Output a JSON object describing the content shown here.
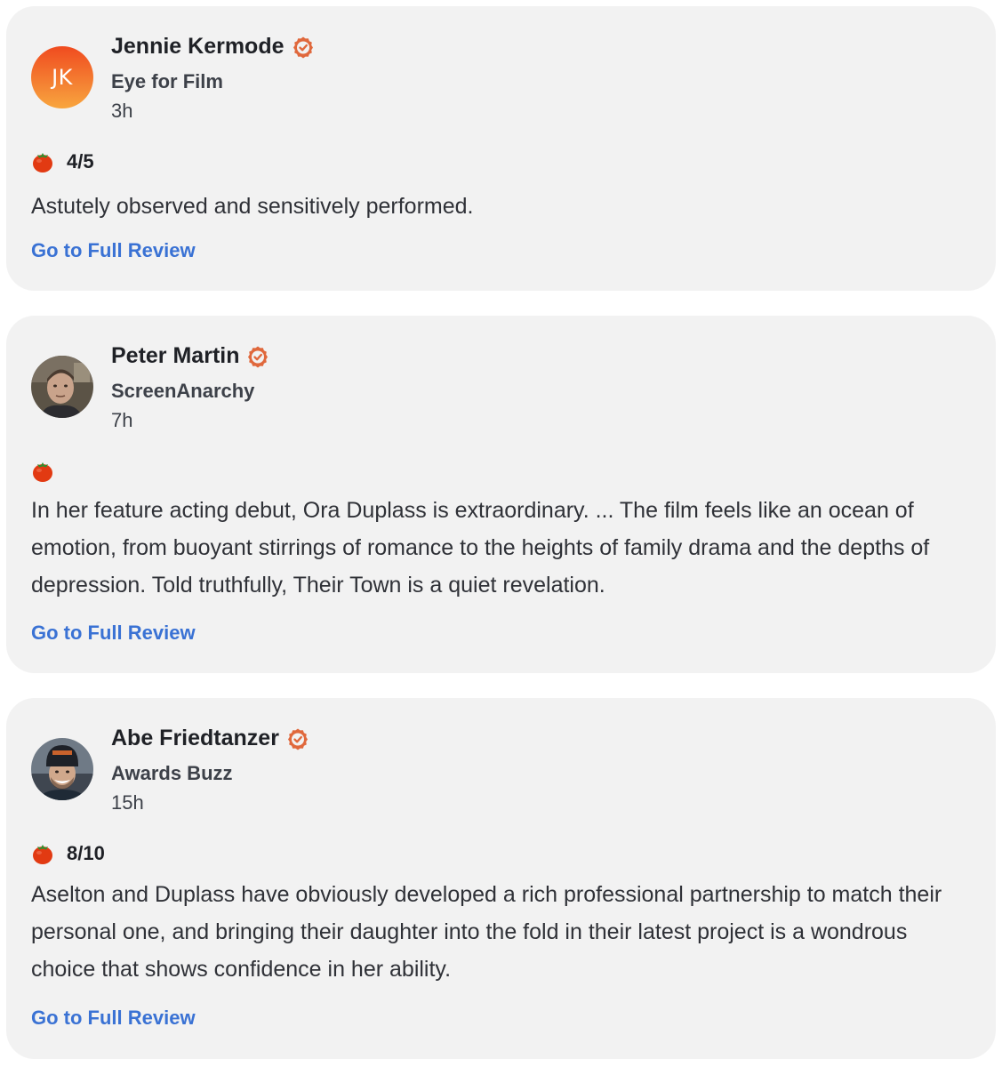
{
  "colors": {
    "card_bg": "#f2f2f2",
    "link": "#3a72d4",
    "verified": "#e0683c",
    "tomato": "#e23a12"
  },
  "reviews": [
    {
      "critic_name": "Jennie Kermode",
      "avatar_initials": "JK",
      "publication": "Eye for Film",
      "time": "3h",
      "score_icon": "tomato-icon",
      "score": "4/5",
      "text": "Astutely observed and sensitively performed.",
      "link_label": "Go to Full Review",
      "verified_icon": "verified-check-icon"
    },
    {
      "critic_name": "Peter Martin",
      "publication": "ScreenAnarchy",
      "time": "7h",
      "score_icon": "tomato-icon",
      "score": "",
      "text": "In her feature acting debut, Ora Duplass is extraordinary. ... The film feels like an ocean of emotion, from buoyant stirrings of romance to the heights of family drama and the depths of depression. Told truthfully, Their Town is a quiet revelation.",
      "link_label": "Go to Full Review",
      "verified_icon": "verified-check-icon"
    },
    {
      "critic_name": "Abe Friedtanzer",
      "publication": "Awards Buzz",
      "time": "15h",
      "score_icon": "tomato-icon",
      "score": "8/10",
      "text": "Aselton and Duplass have obviously developed a rich professional partnership to match their personal one, and bringing their daughter into the fold in their latest project is a wondrous choice that shows confidence in her ability.",
      "link_label": "Go to Full Review",
      "verified_icon": "verified-check-icon"
    }
  ]
}
